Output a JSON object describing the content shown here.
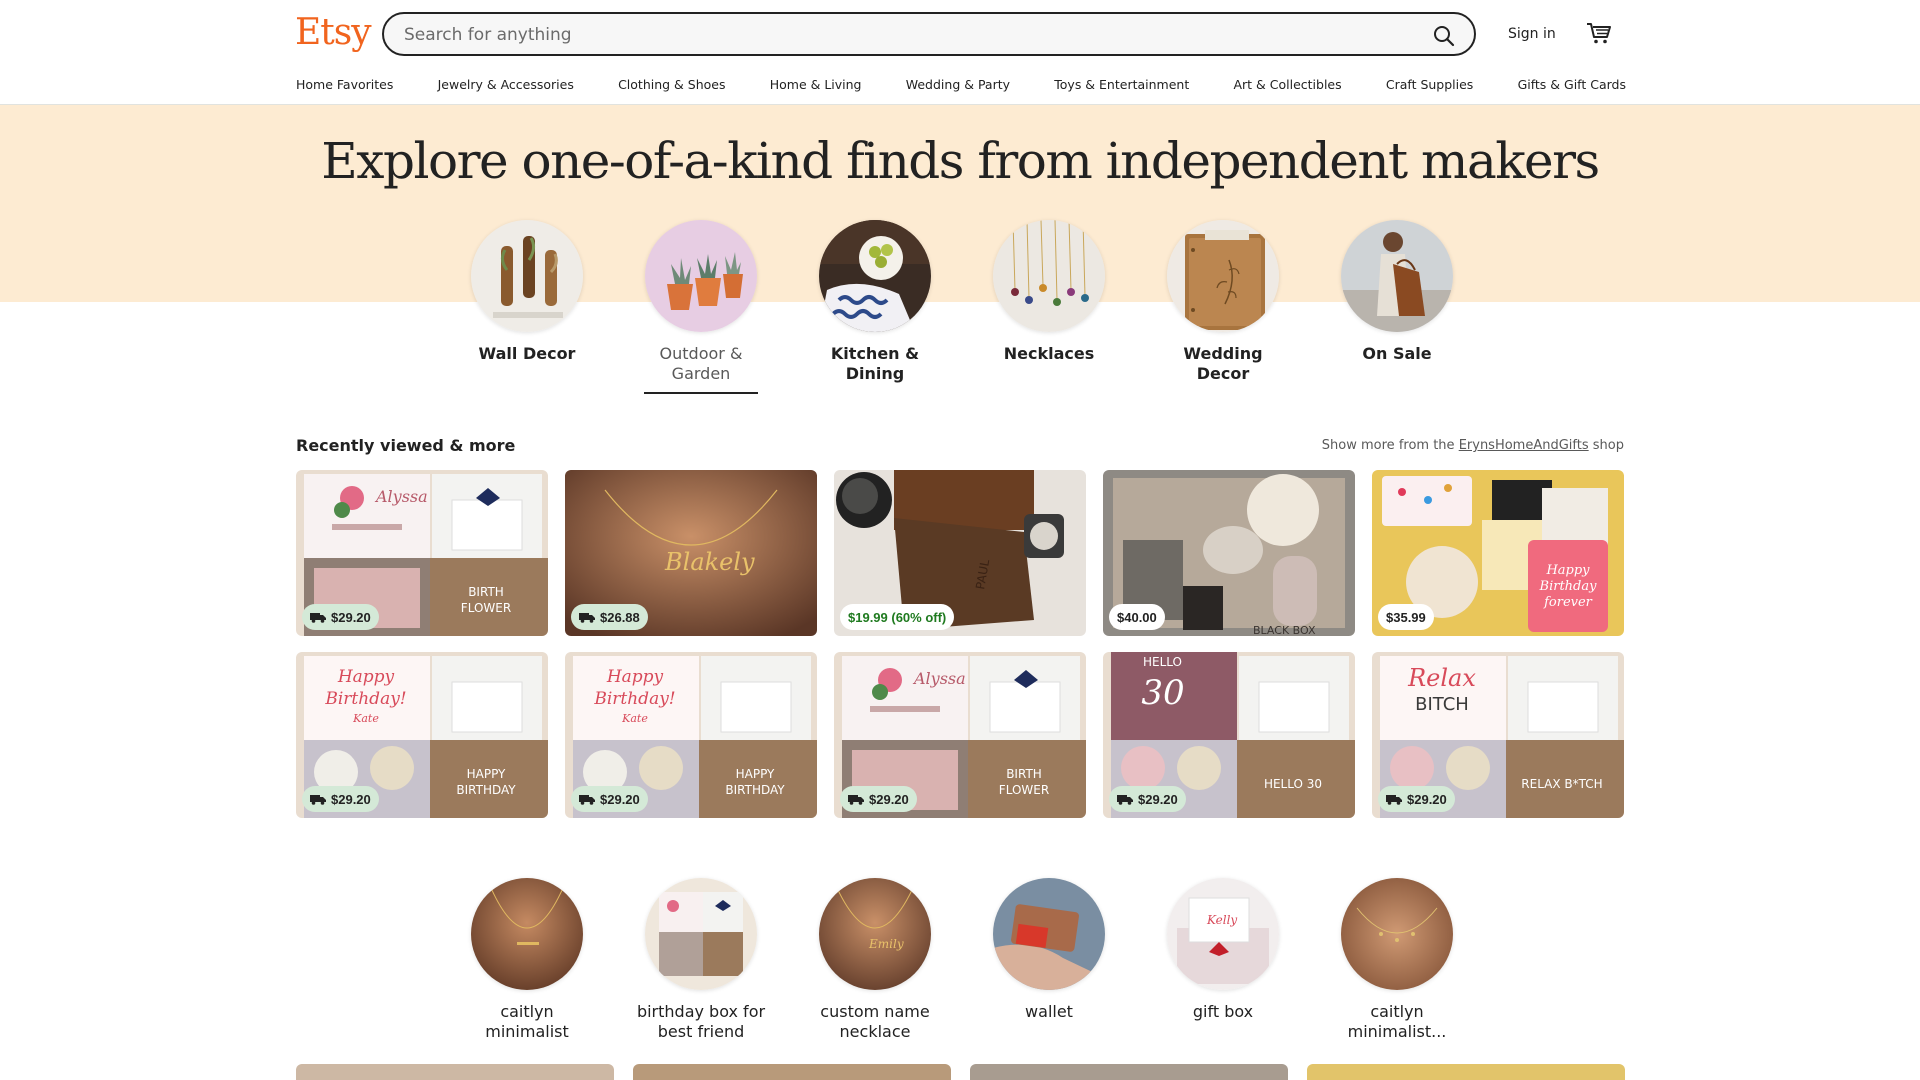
{
  "header": {
    "logo": "Etsy",
    "search_placeholder": "Search for anything",
    "sign_in": "Sign in"
  },
  "categories": [
    "Home Favorites",
    "Jewelry & Accessories",
    "Clothing & Shoes",
    "Home & Living",
    "Wedding & Party",
    "Toys & Entertainment",
    "Art & Collectibles",
    "Craft Supplies",
    "Gifts & Gift Cards"
  ],
  "hero": {
    "title": "Explore one-of-a-kind finds from independent makers"
  },
  "featured": [
    {
      "label": "Wall Decor"
    },
    {
      "label": "Outdoor & Garden",
      "selected": true
    },
    {
      "label": "Kitchen & Dining"
    },
    {
      "label": "Necklaces"
    },
    {
      "label": "Wedding Decor"
    },
    {
      "label": "On Sale"
    }
  ],
  "recent": {
    "title": "Recently viewed & more",
    "show_more_prefix": "Show more from the",
    "shop_name": "ErynsHomeAndGifts",
    "show_more_suffix": "shop",
    "items": [
      {
        "price": "$29.20",
        "free_shipping": true,
        "art": "birth-flower"
      },
      {
        "price": "$26.88",
        "free_shipping": true,
        "art": "necklace"
      },
      {
        "price": "$19.99 (60% off)",
        "free_shipping": false,
        "sale": true,
        "art": "wallet"
      },
      {
        "price": "$40.00",
        "free_shipping": false,
        "art": "spa-box"
      },
      {
        "price": "$35.99",
        "free_shipping": false,
        "art": "bday-box"
      },
      {
        "price": "$29.20",
        "free_shipping": true,
        "art": "happy-birthday"
      },
      {
        "price": "$29.20",
        "free_shipping": true,
        "art": "happy-birthday"
      },
      {
        "price": "$29.20",
        "free_shipping": true,
        "art": "birth-flower"
      },
      {
        "price": "$29.20",
        "free_shipping": true,
        "art": "hello-30"
      },
      {
        "price": "$29.20",
        "free_shipping": true,
        "art": "relax"
      }
    ]
  },
  "searches": [
    {
      "label": "caitlyn minimalist"
    },
    {
      "label": "birthday box for best friend"
    },
    {
      "label": "custom name necklace"
    },
    {
      "label": "wallet"
    },
    {
      "label": "gift box"
    },
    {
      "label": "caitlyn minimalist..."
    }
  ],
  "colors": {
    "brand": "#f1641e",
    "hero_bg": "#fdebd2",
    "free_ship_badge": "#d4e9d7",
    "sale_text": "#1f7a1f"
  }
}
